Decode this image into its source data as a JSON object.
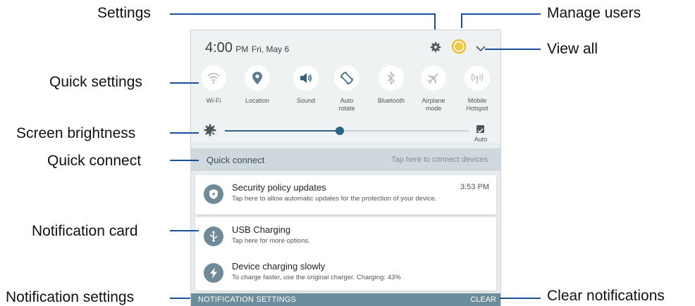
{
  "callouts": {
    "settings": "Settings",
    "manage_users": "Manage users",
    "view_all": "View all",
    "quick_settings": "Quick settings",
    "screen_brightness": "Screen brightness",
    "quick_connect": "Quick connect",
    "notification_card": "Notification card",
    "notification_settings": "Notification settings",
    "clear_notifications": "Clear notifications"
  },
  "status": {
    "time": "4:00",
    "ampm": "PM",
    "date": "Fri, May 6"
  },
  "quick_settings": [
    {
      "label": "Wi-Fi",
      "icon": "wifi-icon"
    },
    {
      "label": "Location",
      "icon": "location-icon"
    },
    {
      "label": "Sound",
      "icon": "sound-icon"
    },
    {
      "label_line1": "Auto",
      "label_line2": "rotate",
      "icon": "auto-rotate-icon"
    },
    {
      "label": "Bluetooth",
      "icon": "bluetooth-icon"
    },
    {
      "label_line1": "Airplane",
      "label_line2": "mode",
      "icon": "airplane-icon"
    },
    {
      "label_line1": "Mobile",
      "label_line2": "Hotspot",
      "icon": "hotspot-icon"
    }
  ],
  "brightness": {
    "level": 0.47,
    "auto_label": "Auto"
  },
  "quick_connect": {
    "title": "Quick connect",
    "hint": "Tap here to connect devices"
  },
  "notifications": [
    {
      "title": "Security policy updates",
      "text": "Tap here to allow automatic updates for the protection of your device.",
      "time": "3:53 PM",
      "icon": "shield-icon"
    },
    {
      "title": "USB Charging",
      "text": "Tap here for more options.",
      "icon": "usb-icon"
    },
    {
      "title": "Device charging slowly",
      "text": "To charge faster, use the original charger. Charging: 43%",
      "icon": "charging-icon"
    }
  ],
  "bottom_bar": {
    "settings_label": "NOTIFICATION SETTINGS",
    "clear_label": "CLEAR"
  },
  "colors": {
    "accent": "#2c6584",
    "callout_line": "#1b4f9c",
    "bottom_bar": "#6b8d9c",
    "quick_connect_bar": "#cfd8dc"
  }
}
